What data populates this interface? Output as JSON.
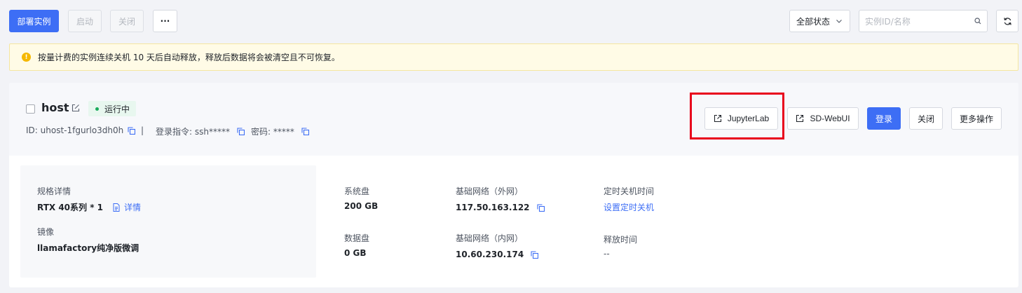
{
  "toolbar": {
    "deploy_label": "部署实例",
    "start_label": "启动",
    "close_label": "关闭",
    "more_label": "···",
    "status_filter": "全部状态",
    "search_placeholder": "实例ID/名称"
  },
  "notice": {
    "text": "按量计费的实例连续关机 10 天后自动释放，释放后数据将会被清空且不可恢复。"
  },
  "instance": {
    "name": "host",
    "status": "运行中",
    "id_text": "ID: uhost-1fgurlo3dh0h",
    "separator": "|",
    "login_cmd_text": "登录指令: ssh*****",
    "password_text": "密码: *****",
    "actions": {
      "jupyter": "JupyterLab",
      "sdwebui": "SD-WebUI",
      "login": "登录",
      "shutdown": "关闭",
      "more": "更多操作"
    }
  },
  "details": {
    "spec_label": "规格详情",
    "spec_value": "RTX 40系列 * 1",
    "spec_link": "详情",
    "image_label": "镜像",
    "image_value": "llamafactory纯净版微调",
    "sys_disk_label": "系统盘",
    "sys_disk_value": "200 GB",
    "data_disk_label": "数据盘",
    "data_disk_value": "0 GB",
    "public_net_label": "基础网络（外网）",
    "public_net_value": "117.50.163.122",
    "private_net_label": "基础网络（内网）",
    "private_net_value": "10.60.230.174",
    "shutdown_time_label": "定时关机时间",
    "shutdown_time_link": "设置定时关机",
    "release_time_label": "释放时间",
    "release_time_value": "--"
  },
  "colors": {
    "primary": "#3d6ef5",
    "running": "#1aab5b",
    "warning": "#f5b800",
    "highlight": "#e8001c"
  }
}
